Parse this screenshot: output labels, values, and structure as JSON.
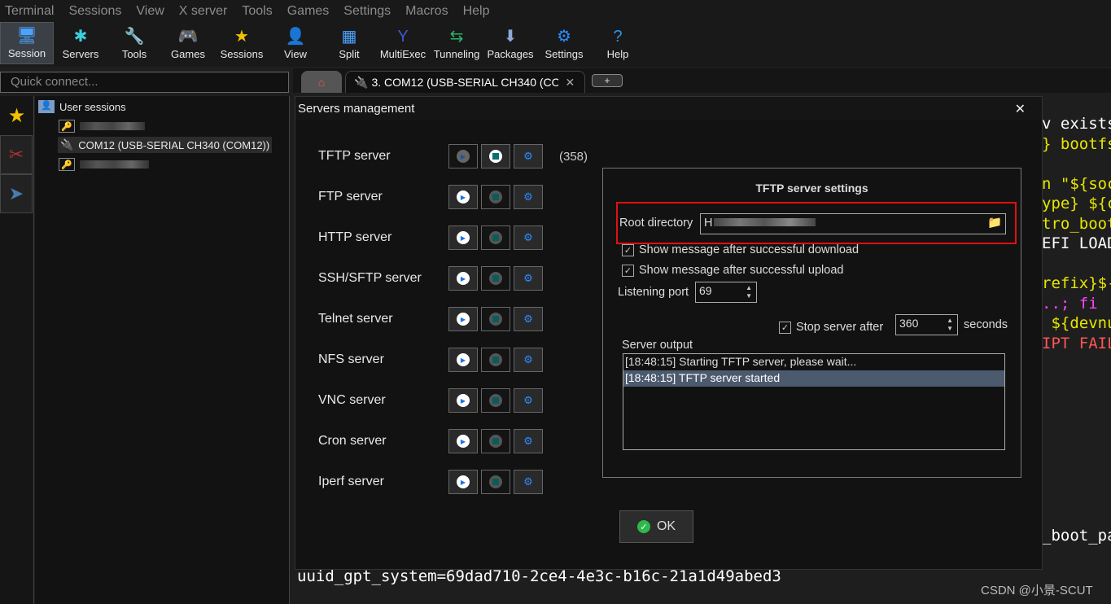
{
  "menu": [
    "Terminal",
    "Sessions",
    "View",
    "X server",
    "Tools",
    "Games",
    "Settings",
    "Macros",
    "Help"
  ],
  "toolbar": [
    {
      "label": "Session",
      "icon": "monitor-icon",
      "glyph": "🖥"
    },
    {
      "label": "Servers",
      "icon": "network-icon",
      "glyph": "✱"
    },
    {
      "label": "Tools",
      "icon": "swiss-knife-icon",
      "glyph": "🔧"
    },
    {
      "label": "Games",
      "icon": "gamepad-icon",
      "glyph": "🎮"
    },
    {
      "label": "Sessions",
      "icon": "star-icon",
      "glyph": "★"
    },
    {
      "label": "View",
      "icon": "view-icon",
      "glyph": "👤"
    },
    {
      "label": "Split",
      "icon": "split-icon",
      "glyph": "▦"
    },
    {
      "label": "MultiExec",
      "icon": "fork-icon",
      "glyph": "Y"
    },
    {
      "label": "Tunneling",
      "icon": "tunnel-icon",
      "glyph": "⇆"
    },
    {
      "label": "Packages",
      "icon": "package-icon",
      "glyph": "⬇"
    },
    {
      "label": "Settings",
      "icon": "gear-icon",
      "glyph": "⚙"
    },
    {
      "label": "Help",
      "icon": "help-icon",
      "glyph": "?"
    }
  ],
  "quick_connect": {
    "placeholder": "Quick connect..."
  },
  "tabs": {
    "active": "3. COM12  (USB-SERIAL CH340 (COM",
    "close": "✕",
    "add": "+"
  },
  "sidebar": {
    "root": "User sessions",
    "items": [
      {
        "label": "",
        "type": "ssh"
      },
      {
        "label": "COM12  (USB-SERIAL CH340 (COM12))",
        "type": "serial"
      },
      {
        "label": "",
        "type": "ssh"
      }
    ]
  },
  "terminal": {
    "right_lines": [
      {
        "t": "v exists",
        "c": "#ffffff"
      },
      {
        "t": "} bootfs",
        "c": "#e6e600"
      },
      {
        "t": "",
        "c": "#fff"
      },
      {
        "t": "n \"${soc",
        "c": "#e6e600"
      },
      {
        "t": "ype} ${c",
        "c": "#e6e600"
      },
      {
        "t": "tro_boot",
        "c": "#e6e600"
      },
      {
        "t": "EFI LOAD",
        "c": "#ffffff"
      },
      {
        "t": "",
        "c": "#fff"
      },
      {
        "t": "refix}$-",
        "c": "#e6e600"
      },
      {
        "t": "..; fi",
        "c": "#ff44ff"
      },
      {
        "t": " ${devnu",
        "c": "#e6e600"
      },
      {
        "t": "IPT FAIL",
        "c": "#ff5555"
      }
    ],
    "boot_fragment": "_boot_pa",
    "uuid_line": "uuid_gpt_system=69dad710-2ce4-4e3c-b16c-21a1d49abed3"
  },
  "dialog": {
    "title": "Servers management",
    "close": "✕",
    "servers": [
      {
        "name": "TFTP server",
        "running": true,
        "count": "(358)"
      },
      {
        "name": "FTP server",
        "running": false
      },
      {
        "name": "HTTP server",
        "running": false
      },
      {
        "name": "SSH/SFTP server",
        "running": false
      },
      {
        "name": "Telnet server",
        "running": false
      },
      {
        "name": "NFS server",
        "running": false
      },
      {
        "name": "VNC server",
        "running": false
      },
      {
        "name": "Cron server",
        "running": false
      },
      {
        "name": "Iperf server",
        "running": false
      }
    ],
    "settings": {
      "title": "TFTP server settings",
      "root_label": "Root directory",
      "root_value": "H",
      "show_download": "Show message after successful download",
      "show_download_checked": true,
      "show_upload": "Show message after successful upload",
      "show_upload_checked": true,
      "port_label": "Listening port",
      "port": "69",
      "stop_label": "Stop server after",
      "stop_checked": true,
      "stop_value": "360",
      "seconds": "seconds",
      "output_label": "Server output",
      "output": [
        "[18:48:15] Starting TFTP server, please wait...",
        "[18:48:15] TFTP server started"
      ]
    },
    "ok": "OK",
    "highlight_color": "#e01010"
  },
  "watermark": "CSDN @小景-SCUT"
}
